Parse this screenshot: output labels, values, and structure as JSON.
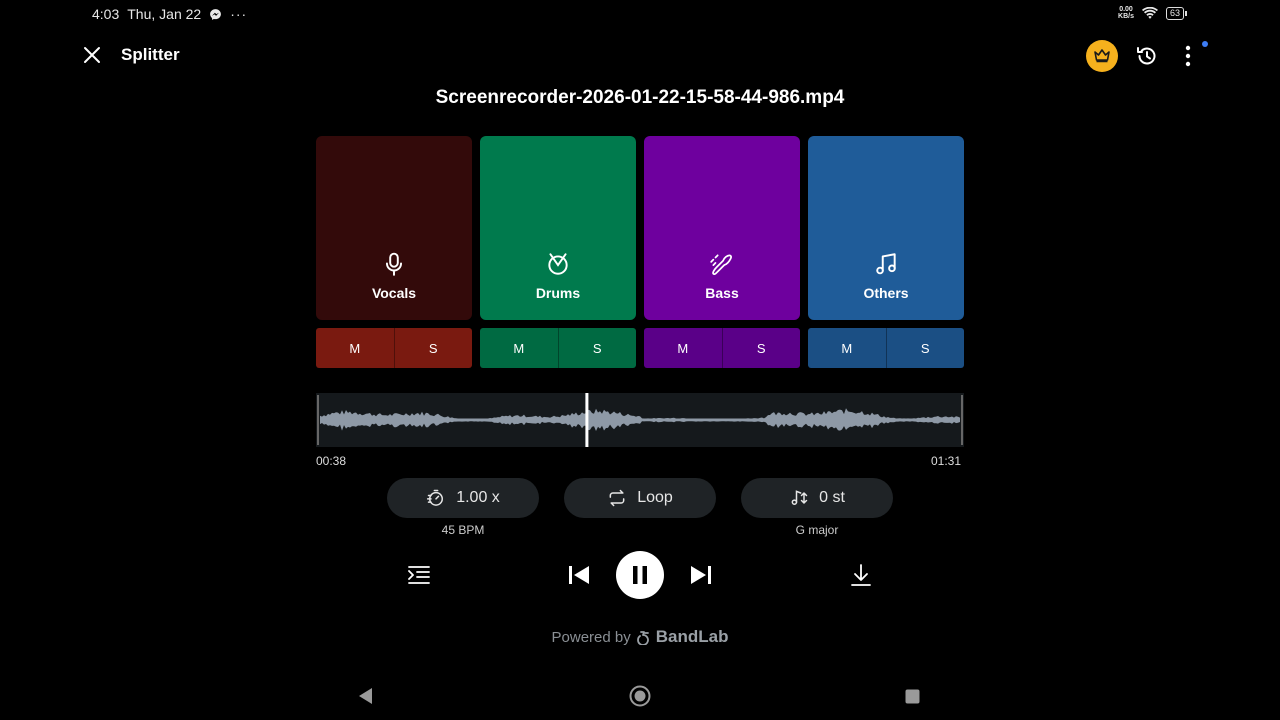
{
  "status_bar": {
    "time": "4:03",
    "date": "Thu, Jan 22",
    "more": "···",
    "net_speed_value": "0.00",
    "net_speed_unit": "KB/s",
    "battery": "63"
  },
  "header": {
    "app_title": "Splitter",
    "file_name": "Screenrecorder-2026-01-22-15-58-44-986.mp4"
  },
  "stems": [
    {
      "label": "Vocals",
      "icon": "microphone-icon",
      "color": "#330a0a",
      "ms_color": "#7a1a10",
      "mute": "M",
      "solo": "S"
    },
    {
      "label": "Drums",
      "icon": "drum-icon",
      "color": "#007a4d",
      "ms_color": "#006a42",
      "mute": "M",
      "solo": "S"
    },
    {
      "label": "Bass",
      "icon": "guitar-icon",
      "color": "#6e009e",
      "ms_color": "#5a0088",
      "mute": "M",
      "solo": "S"
    },
    {
      "label": "Others",
      "icon": "music-note-icon",
      "color": "#1f5c99",
      "ms_color": "#1b4f84",
      "mute": "M",
      "solo": "S"
    }
  ],
  "playback": {
    "current_time": "00:38",
    "total_time": "01:31",
    "progress": 0.418
  },
  "controls": {
    "speed": "1.00 x",
    "bpm": "45 BPM",
    "loop": "Loop",
    "pitch": "0 st",
    "key": "G major"
  },
  "footer": {
    "powered_by": "Powered by",
    "brand": "BandLab"
  },
  "colors": {
    "accent": "#f6b11d",
    "waveform": "#8e99a6",
    "background": "#000000"
  }
}
